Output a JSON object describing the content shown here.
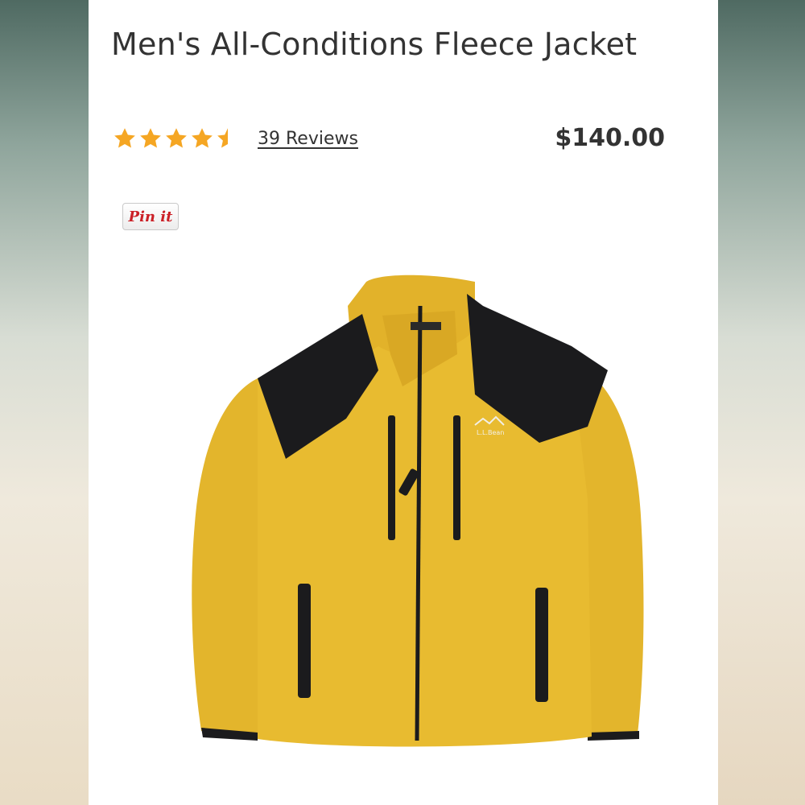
{
  "product": {
    "title": "Men's All-Conditions Fleece Jacket",
    "rating": 4.5,
    "rating_max": 5,
    "reviews_label": "39 Reviews",
    "price": "$140.00"
  },
  "share": {
    "pinit_label": "Pin it"
  },
  "image": {
    "brand_mark": "L.L.Bean"
  },
  "colors": {
    "star_gold": "#f5a623",
    "jacket_yellow": "#e5b92f",
    "jacket_black": "#1b1b1d",
    "pinit_red": "#cb2027"
  }
}
